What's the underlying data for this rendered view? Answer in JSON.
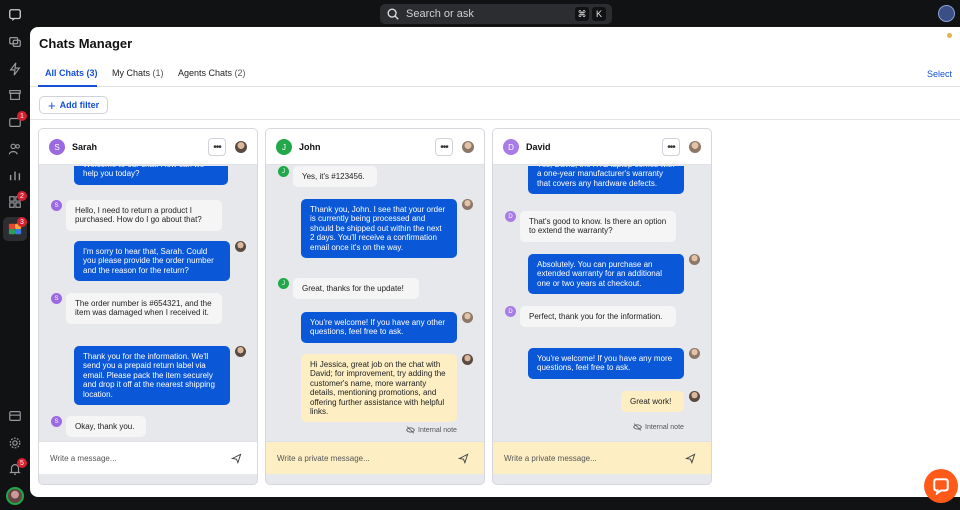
{
  "search": {
    "placeholder": "Search or ask",
    "key1": "⌘",
    "key2": "K"
  },
  "rail": {
    "badges": [
      "1",
      "2",
      "3",
      "5"
    ]
  },
  "header": {
    "title": "Chats Manager"
  },
  "tabs": [
    {
      "label": "All Chats",
      "count": "(3)"
    },
    {
      "label": "My Chats",
      "count": "(1)"
    },
    {
      "label": "Agents Chats",
      "count": "(2)"
    }
  ],
  "select_label": "Select",
  "filter": {
    "label": "Add filter"
  },
  "internal_note_label": "Internal note",
  "columns": [
    {
      "name": "Sarah",
      "initial": "S",
      "messages": [
        {
          "text": "Welcome to our chat. How can we help you today?"
        },
        {
          "text": "Hello, I need to return a product I purchased. How do I go about that?"
        },
        {
          "text": "I'm sorry to hear that, Sarah. Could you please provide the order number and the reason for the return?"
        },
        {
          "text": "The order number is #654321, and the item was damaged when I received it."
        },
        {
          "text": "Thank you for the information. We'll send you a prepaid return label via email. Please pack the item securely and drop it off at the nearest shipping location."
        },
        {
          "text": "Okay, thank you."
        }
      ],
      "composer": "Write a message..."
    },
    {
      "name": "John",
      "initial": "J",
      "messages": [
        {
          "text": "Yes, it's #123456."
        },
        {
          "text": "Thank you, John. I see that your order is currently being processed and should be shipped out within the next 2 days. You'll receive a confirmation email once it's on the way."
        },
        {
          "text": "Great, thanks for the update!"
        },
        {
          "text": "You're welcome! If you have any other questions, feel free to ask."
        },
        {
          "text": "Hi Jessica, great job on the chat with David; for improvement, try adding the customer's name, more warranty details, mentioning promotions, and offering further assistance with helpful links."
        }
      ],
      "composer": "Write a private message..."
    },
    {
      "name": "David",
      "initial": "D",
      "messages": [
        {
          "text": "Yes, David, the XYZ laptop comes with a one-year manufacturer's warranty that covers any hardware defects."
        },
        {
          "text": "That's good to know. Is there an option to extend the warranty?"
        },
        {
          "text": "Absolutely. You can purchase an extended warranty for an additional one or two years at checkout."
        },
        {
          "text": "Perfect, thank you for the information."
        },
        {
          "text": "You're welcome! If you have any more questions, feel free to ask."
        },
        {
          "text": "Great work!"
        }
      ],
      "composer": "Write a private message..."
    }
  ]
}
